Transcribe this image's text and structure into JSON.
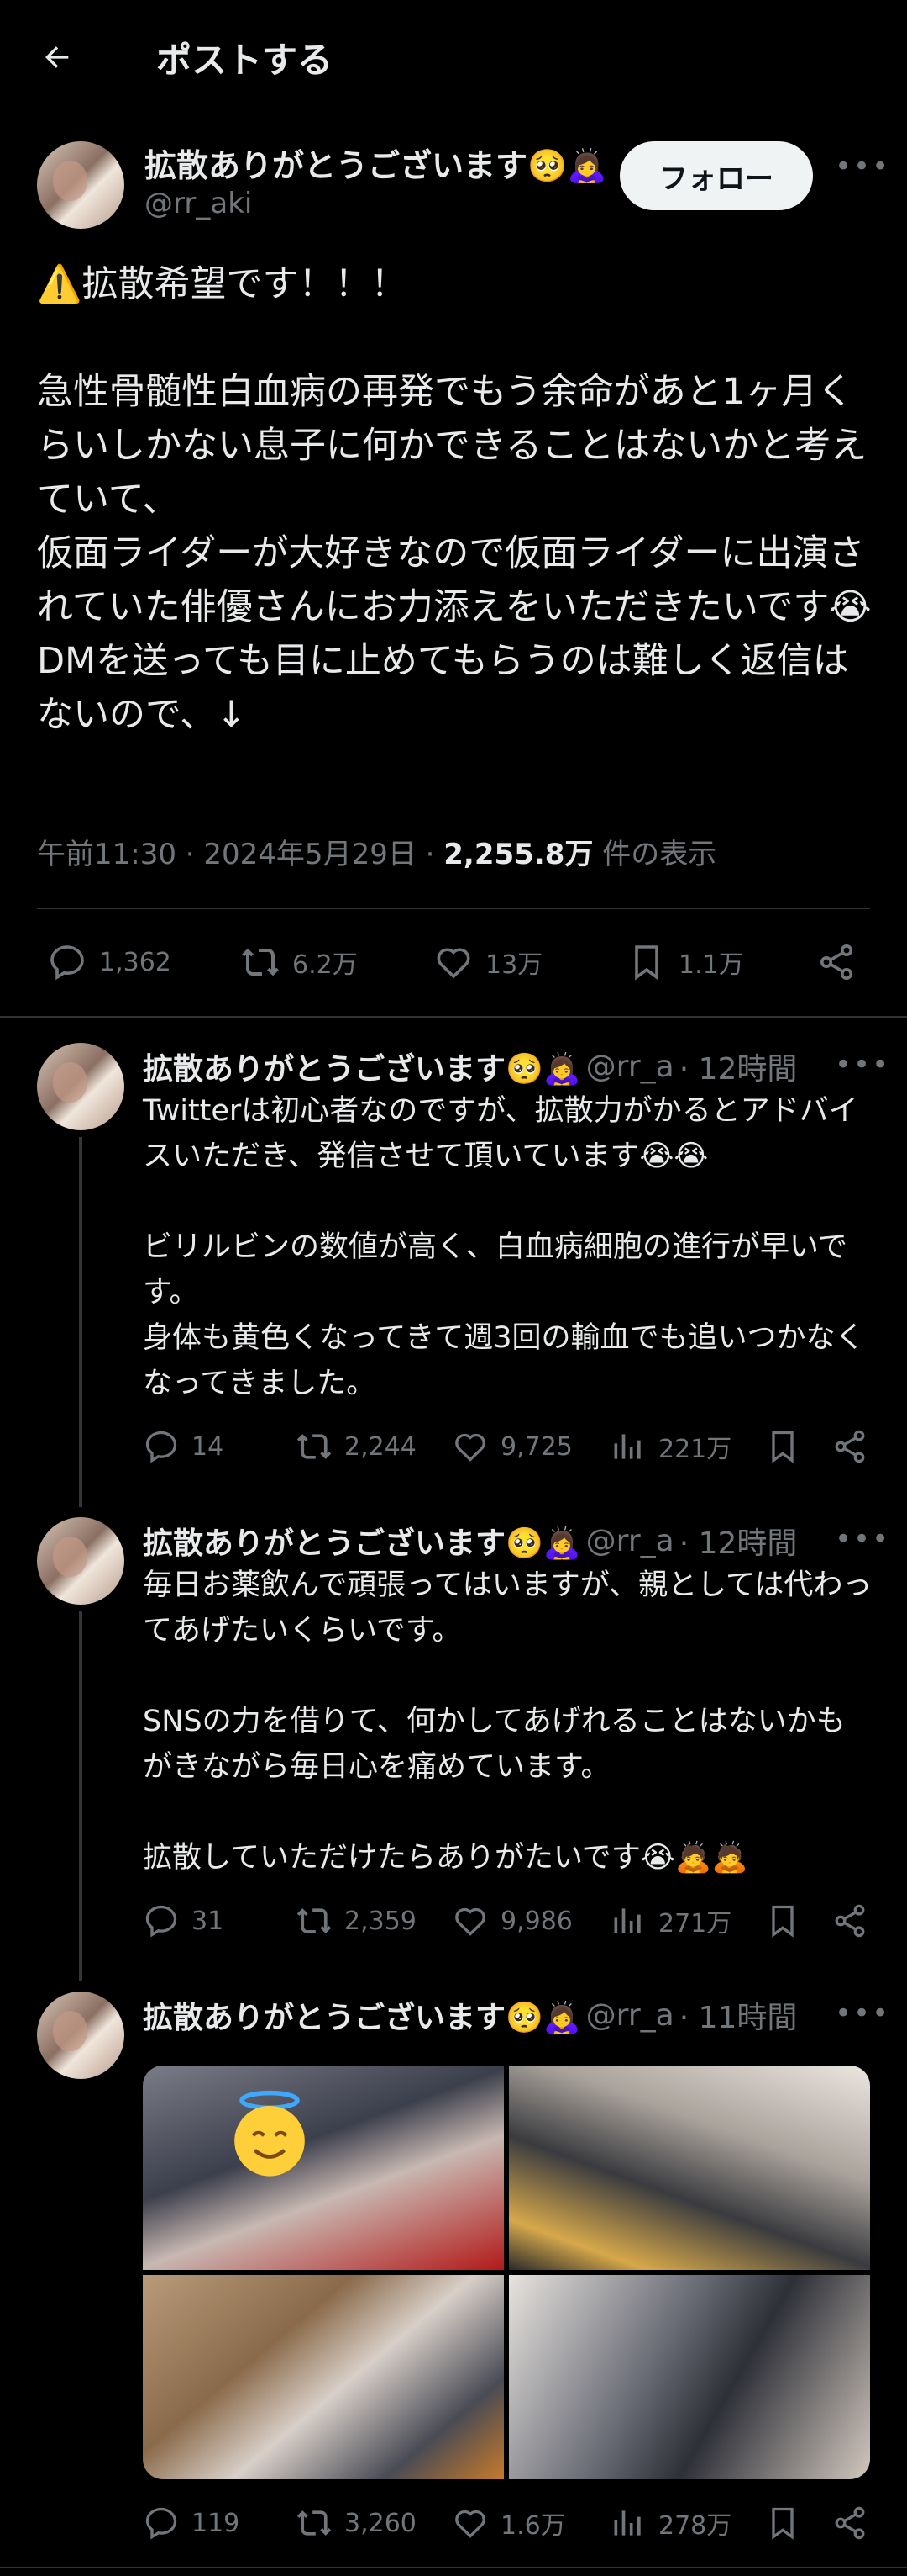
{
  "header": {
    "title": "ポストする"
  },
  "main_post": {
    "display_name": "拡散ありがとうございます🥺🙇‍♀️",
    "handle": "@rr_aki",
    "follow_label": "フォロー",
    "text": "⚠️拡散希望です！！！\n\n急性骨髄性白血病の再発でもう余命があと1ヶ月くらいしかない息子に何かできることはないかと考えていて、\n仮面ライダーが大好きなので仮面ライダーに出演されていた俳優さんにお力添えをいただきたいです😭\nDMを送っても目に止めてもらうのは難しく返信はないので、↓",
    "time": "午前11:30 · 2024年5月29日 · ",
    "views": "2,255.8万",
    "views_suffix": " 件の表示",
    "replies": "1,362",
    "reposts": "6.2万",
    "likes": "13万",
    "bookmarks": "1.1万"
  },
  "replies": [
    {
      "display_name": "拡散ありがとうございます🥺🙇‍♀️",
      "handle": "@rr_a",
      "time": "· 12時間",
      "text": "Twitterは初心者なのですが、拡散力がかるとアドバイスいただき、発信させて頂いています😭😭\n\nビリルビンの数値が高く、白血病細胞の進行が早いです。\n身体も黄色くなってきて週3回の輸血でも追いつかなくなってきました。",
      "replies": "14",
      "reposts": "2,244",
      "likes": "9,725",
      "views": "221万"
    },
    {
      "display_name": "拡散ありがとうございます🥺🙇‍♀️",
      "handle": "@rr_a",
      "time": "· 12時間",
      "text": "毎日お薬飲んで頑張ってはいますが、親としては代わってあげたいくらいです。\n\nSNSの力を借りて、何かしてあげれることはないかもがきながら毎日心を痛めています。\n\n拡散していただけたらありがたいです😭🙇🙇",
      "replies": "31",
      "reposts": "2,359",
      "likes": "9,986",
      "views": "271万"
    },
    {
      "display_name": "拡散ありがとうございます🥺🙇‍♀️",
      "handle": "@rr_a",
      "time": "· 11時間",
      "text": "",
      "replies": "119",
      "reposts": "3,260",
      "likes": "1.6万",
      "views": "278万"
    }
  ],
  "icons": [
    "back-arrow-icon",
    "more-icon",
    "reply-icon",
    "repost-icon",
    "like-icon",
    "bookmark-icon",
    "share-icon",
    "views-icon"
  ],
  "colors": {
    "background": "#000000",
    "text": "#e7e9ea",
    "muted": "#71767b",
    "follow_bg": "#eff3f4"
  }
}
